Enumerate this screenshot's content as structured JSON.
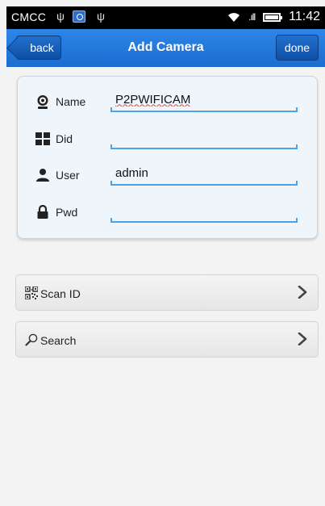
{
  "status_bar": {
    "carrier": "CMCC",
    "usb_symbol": "ψ",
    "signal_bars": ".ıll",
    "time": "11:42"
  },
  "title_bar": {
    "back_label": "back",
    "title": "Add Camera",
    "done_label": "done"
  },
  "form": {
    "name": {
      "label": "Name",
      "value": "P2PWIFICAM",
      "icon": "webcam-icon"
    },
    "did": {
      "label": "Did",
      "value": "",
      "icon": "grid-icon"
    },
    "user": {
      "label": "User",
      "value": "admin",
      "icon": "user-icon"
    },
    "pwd": {
      "label": "Pwd",
      "value": "",
      "icon": "lock-icon"
    }
  },
  "actions": {
    "scan": {
      "label": "Scan ID",
      "icon": "qr-code-icon"
    },
    "search": {
      "label": "Search",
      "icon": "magnifier-icon"
    }
  },
  "colors": {
    "accent": "#1b6cd0",
    "field_underline": "#4ea3e6",
    "card_bg": "#eef6fb"
  }
}
